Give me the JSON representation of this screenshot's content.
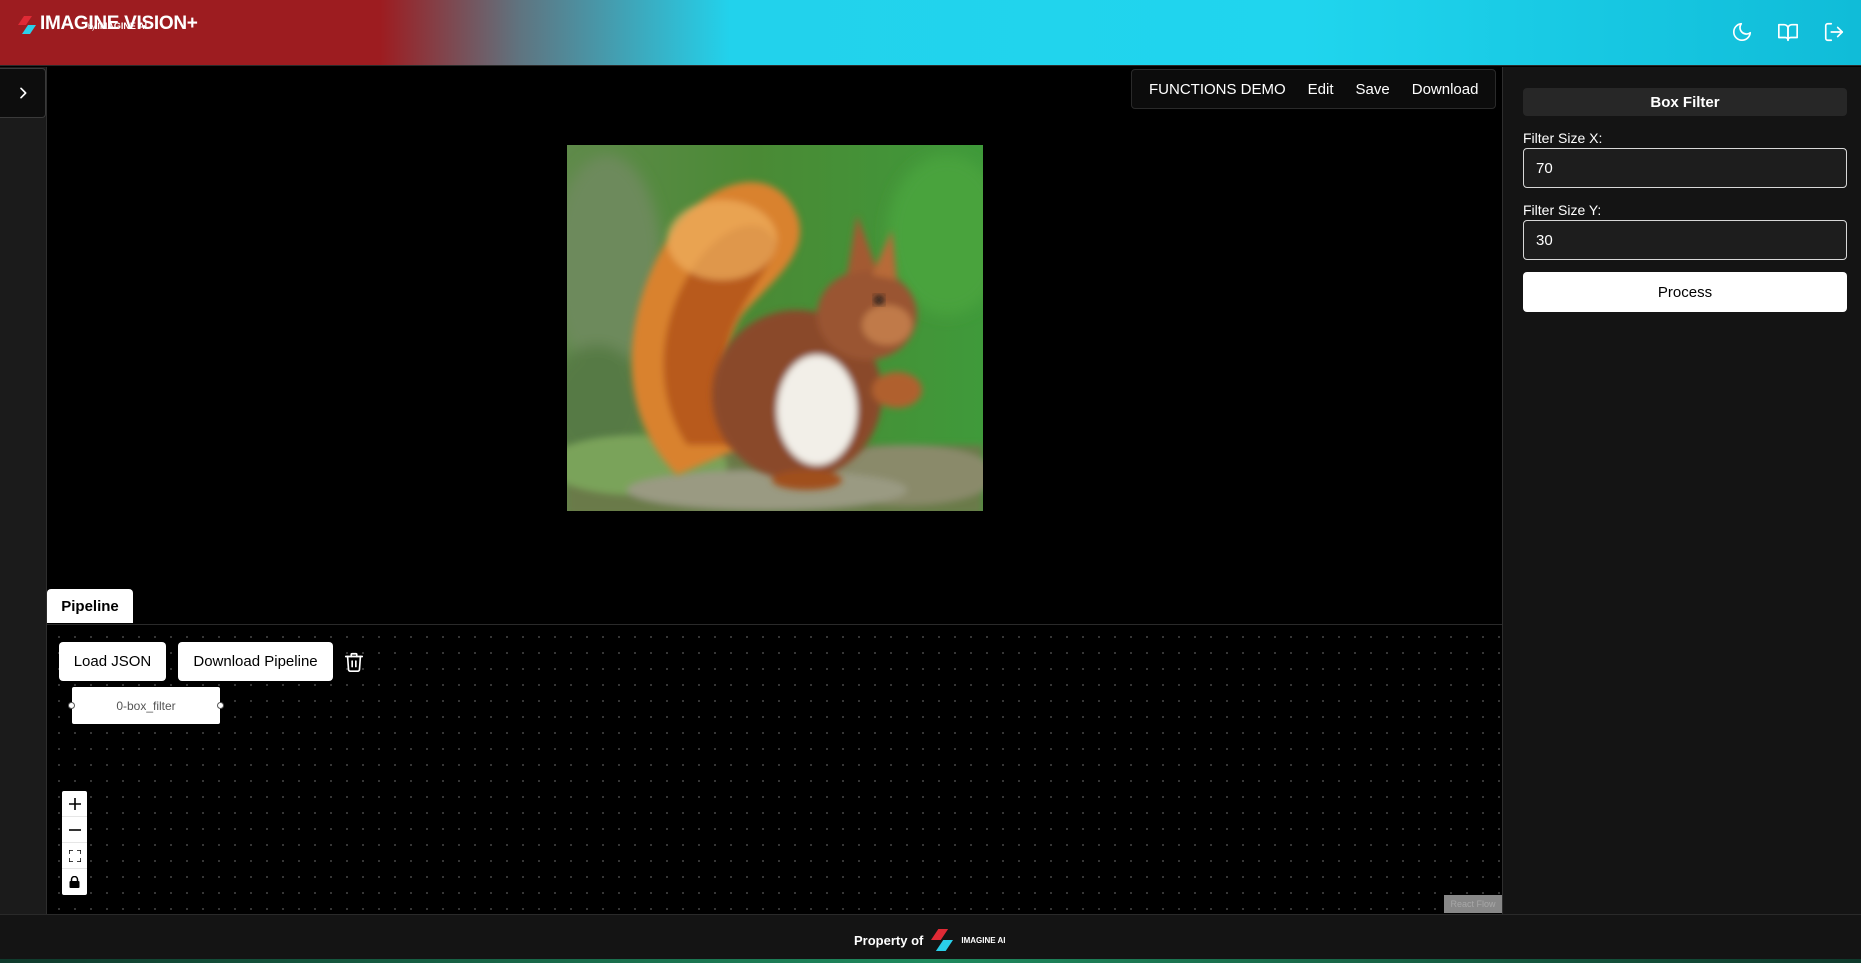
{
  "header": {
    "logo_text": "IMAGINE VISION+",
    "logo_by": "by",
    "logo_sub": "IMAGINE AI",
    "icons": [
      "moon-icon",
      "book-icon",
      "logout-icon"
    ]
  },
  "menubar": {
    "items": [
      "FUNCTIONS DEMO",
      "Edit",
      "Save",
      "Download"
    ]
  },
  "pipeline": {
    "tab_label": "Pipeline",
    "load_json_label": "Load JSON",
    "download_pipeline_label": "Download Pipeline",
    "node_label": "0-box_filter",
    "attribution_label": "React Flow"
  },
  "panel": {
    "title": "Box Filter",
    "filter_x_label": "Filter Size X:",
    "filter_x_value": "70",
    "filter_y_label": "Filter Size Y:",
    "filter_y_value": "30",
    "process_label": "Process"
  },
  "footer": {
    "label": "Property of",
    "brand": "IMAGINE AI"
  },
  "colors": {
    "header_red": "#9d1c20",
    "header_cyan": "#20d5ee",
    "logo_red": "#e02a35",
    "logo_cyan": "#2ad0ea"
  }
}
